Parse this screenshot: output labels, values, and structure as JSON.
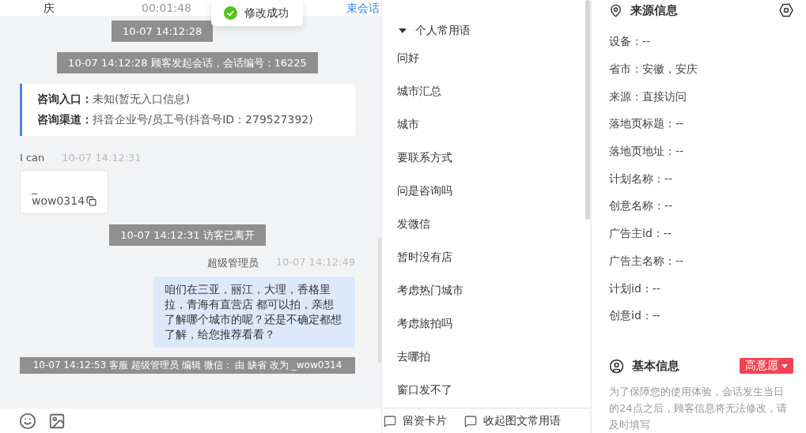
{
  "header": {
    "name": "庆",
    "timer": "00:01:48",
    "end_link": "束会话"
  },
  "toast": {
    "message": "修改成功"
  },
  "messages": [
    {
      "kind": "system",
      "text": "10-07 14:12:28"
    },
    {
      "kind": "system",
      "text": "10-07 14:12:28 顾客发起会话，会话编号：16225"
    },
    {
      "kind": "info",
      "rows": [
        {
          "label": "咨询入口：",
          "value": "未知(暂无入口信息)"
        },
        {
          "label": "咨询渠道：",
          "value": "抖音企业号/员工号(抖音号ID：279527392)"
        }
      ]
    },
    {
      "kind": "visitor",
      "sender": "I can",
      "time": "10-07 14:12:31",
      "lines": [
        "_",
        "wow0314"
      ]
    },
    {
      "kind": "system",
      "text": "10-07 14:12:31 访客已离开"
    },
    {
      "kind": "agent",
      "sender": "超级管理员",
      "time": "10-07 14:12:49",
      "text": "咱们在三亚，丽江，大理，香格里拉，青海有直营店 都可以拍，亲想了解哪个城市的呢？还是不确定都想了解，给您推荐看看？"
    },
    {
      "kind": "system",
      "text": "10-07 14:12:53 客服 超级管理员 编辑 微信： 由 缺省 改为 _wow0314"
    }
  ],
  "phrases": {
    "group": "个人常用语",
    "expanded": true,
    "items": [
      "问好",
      "城市汇总",
      "城市",
      "要联系方式",
      "问是咨询吗",
      "发微信",
      "暂时没有店",
      "考虑热门城市",
      "考虑旅拍吗",
      "去哪拍",
      "窗口发不了"
    ]
  },
  "bottom_actions": [
    "留资卡片",
    "收起图文常用语"
  ],
  "source_info": {
    "title": "来源信息",
    "rows": [
      "设备：--",
      "省市：安徽，安庆",
      "来源：直接访问",
      "落地页标题：--",
      "落地页地址：--",
      "计划名称：--",
      "创意名称：--",
      "广告主id：--",
      "广告主名称：--",
      "计划id：--",
      "创意id：--"
    ]
  },
  "basic_info": {
    "title": "基本信息",
    "tag": "高意愿",
    "notice": "为了保障您的使用体验，会话发生当日的24点之后，顾客信息将无法修改，请及时填写"
  }
}
